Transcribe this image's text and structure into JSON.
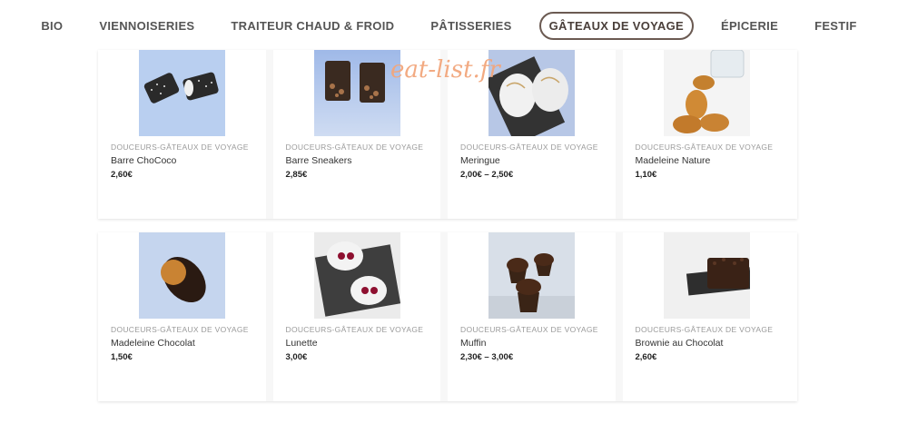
{
  "nav": {
    "items": [
      {
        "label": "BIO"
      },
      {
        "label": "VIENNOISERIES"
      },
      {
        "label": "TRAITEUR CHAUD & FROID"
      },
      {
        "label": "PÂTISSERIES"
      },
      {
        "label": "GÂTEAUX DE VOYAGE"
      },
      {
        "label": "ÉPICERIE"
      },
      {
        "label": "FESTIF"
      }
    ],
    "active_index": 4
  },
  "watermark": "eat-list.fr",
  "products": [
    {
      "category": "DOUCEURS-GÂTEAUX DE VOYAGE",
      "name": "Barre ChoCoco",
      "price": "2,60€",
      "image_icon": "chococo-bar-photo"
    },
    {
      "category": "DOUCEURS-GÂTEAUX DE VOYAGE",
      "name": "Barre Sneakers",
      "price": "2,85€",
      "image_icon": "sneakers-bar-photo"
    },
    {
      "category": "DOUCEURS-GÂTEAUX DE VOYAGE",
      "name": "Meringue",
      "price": "2,00€ – 2,50€",
      "image_icon": "meringue-photo"
    },
    {
      "category": "DOUCEURS-GÂTEAUX DE VOYAGE",
      "name": "Madeleine Nature",
      "price": "1,10€",
      "image_icon": "madeleine-nature-photo"
    },
    {
      "category": "DOUCEURS-GÂTEAUX DE VOYAGE",
      "name": "Madeleine Chocolat",
      "price": "1,50€",
      "image_icon": "madeleine-chocolat-photo"
    },
    {
      "category": "DOUCEURS-GÂTEAUX DE VOYAGE",
      "name": "Lunette",
      "price": "3,00€",
      "image_icon": "lunette-photo"
    },
    {
      "category": "DOUCEURS-GÂTEAUX DE VOYAGE",
      "name": "Muffin",
      "price": "2,30€ – 3,00€",
      "image_icon": "muffin-photo"
    },
    {
      "category": "DOUCEURS-GÂTEAUX DE VOYAGE",
      "name": "Brownie au Chocolat",
      "price": "2,60€",
      "image_icon": "brownie-photo"
    }
  ],
  "colors": {
    "accent_border": "#6b5a52",
    "watermark": "#f2a67c"
  }
}
